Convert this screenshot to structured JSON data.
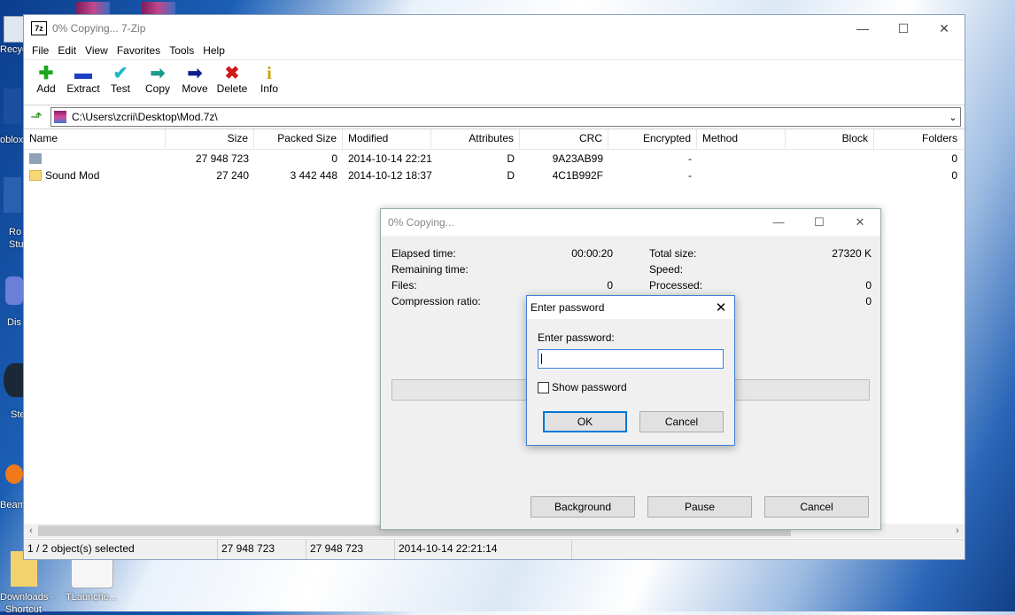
{
  "desktop": {
    "labels": {
      "recycle": "Recyc",
      "roblox": "oblox",
      "studio_top": "Ro",
      "studio_bottom": "Stu",
      "discord": "Dis",
      "steam": "Ste",
      "beam": "Beam",
      "downloads": "Downloads -",
      "downloads2": "Shortcut",
      "tlauncher": "TLaunche..."
    }
  },
  "window": {
    "title": "0% Copying... 7-Zip",
    "app_icon": "7z",
    "controls": {
      "min": "—",
      "max": "☐",
      "close": "✕"
    }
  },
  "menu": [
    "File",
    "Edit",
    "View",
    "Favorites",
    "Tools",
    "Help"
  ],
  "toolbar": [
    {
      "label": "Add",
      "icon": "add-icon",
      "glyph": "✚",
      "color": "#1aa81a"
    },
    {
      "label": "Extract",
      "icon": "extract-icon",
      "glyph": "▬",
      "color": "#1b3fc4"
    },
    {
      "label": "Test",
      "icon": "test-icon",
      "glyph": "✔",
      "color": "#1cb9c4"
    },
    {
      "label": "Copy",
      "icon": "copy-icon",
      "glyph": "➡",
      "color": "#1c9b8b"
    },
    {
      "label": "Move",
      "icon": "move-icon",
      "glyph": "➡",
      "color": "#0f1c8c"
    },
    {
      "label": "Delete",
      "icon": "delete-icon",
      "glyph": "✖",
      "color": "#d01818"
    },
    {
      "label": "Info",
      "icon": "info-icon",
      "glyph": "i",
      "color": "#c9a400"
    }
  ],
  "address": {
    "path": "C:\\Users\\zcrii\\Desktop\\Mod.7z\\"
  },
  "columns": [
    "Name",
    "Size",
    "Packed Size",
    "Modified",
    "Attributes",
    "CRC",
    "Encrypted",
    "Method",
    "Block",
    "Folders"
  ],
  "rows": [
    {
      "name": "",
      "size": "27 948 723",
      "packed": "0",
      "modified": "2014-10-14 22:21",
      "attributes": "D",
      "crc": "9A23AB99",
      "encrypted": "-",
      "method": "",
      "block": "",
      "folders": "0",
      "folder_color": "gray"
    },
    {
      "name": "Sound Mod",
      "size": "27 240",
      "packed": "3 442 448",
      "modified": "2014-10-12 18:37",
      "attributes": "D",
      "crc": "4C1B992F",
      "encrypted": "-",
      "method": "",
      "block": "",
      "folders": "0",
      "folder_color": "yellow"
    }
  ],
  "status": {
    "selected": "1 / 2 object(s) selected",
    "size": "27 948 723",
    "packed": "27 948 723",
    "modified": "2014-10-14 22:21:14"
  },
  "copy_dialog": {
    "title": "0% Copying...",
    "elapsed_label": "Elapsed time:",
    "elapsed_value": "00:00:20",
    "remaining_label": "Remaining time:",
    "files_label": "Files:",
    "files_value": "0",
    "compression_label": "Compression ratio:",
    "total_label": "Total size:",
    "total_value": "27320 K",
    "speed_label": "Speed:",
    "processed_label": "Processed:",
    "processed_value": "0",
    "extra_value": "0",
    "background_btn": "Background",
    "pause_btn": "Pause",
    "cancel_btn": "Cancel"
  },
  "password_dialog": {
    "title": "Enter password",
    "label": "Enter password:",
    "value": "",
    "show_password": "Show password",
    "ok": "OK",
    "cancel": "Cancel"
  }
}
